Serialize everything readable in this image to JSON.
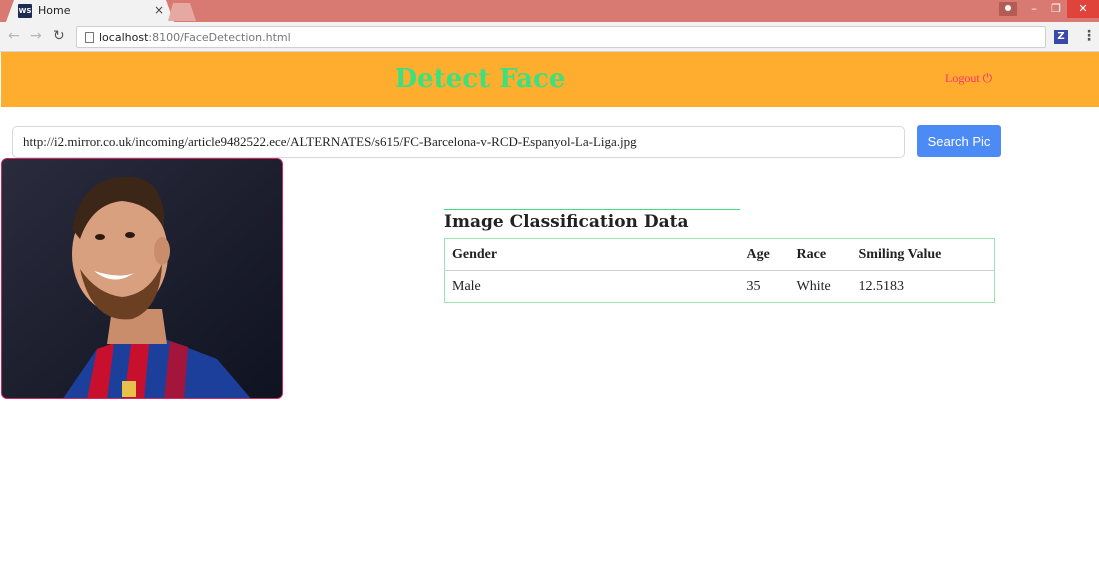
{
  "browser": {
    "tab": {
      "favicon": "WS",
      "title": "Home",
      "close": "×"
    },
    "address": {
      "host": "localhost",
      "path": ":8100/FaceDetection.html"
    },
    "extension_label": "Z",
    "window_buttons": {
      "minimize": "–",
      "restore": "❐",
      "close": "✕"
    }
  },
  "header": {
    "title": "Detect Face",
    "logout_label": "Logout ⏻",
    "background": "#ffad2f",
    "title_color": "#3de07c"
  },
  "search": {
    "value": "http://i2.mirror.co.uk/incoming/article9482522.ece/ALTERNATES/s615/FC-Barcelona-v-RCD-Espanyol-La-Liga.jpg",
    "button_label": "Search Pic",
    "button_color": "#4c8bf5"
  },
  "results": {
    "title": "Image Classification Data",
    "columns": [
      "Gender",
      "Age",
      "Race",
      "Smiling Value"
    ],
    "rows": [
      [
        "Male",
        "35",
        "White",
        "12.5183"
      ]
    ]
  },
  "icons": [
    "back-arrow-icon",
    "forward-arrow-icon",
    "reload-icon",
    "page-icon",
    "power-icon",
    "menu-dots-icon"
  ]
}
